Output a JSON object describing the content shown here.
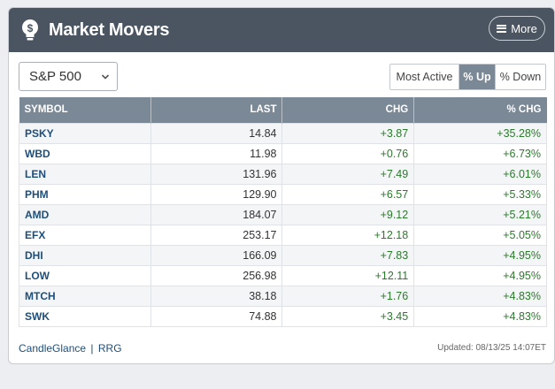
{
  "header": {
    "title": "Market Movers",
    "more_label": "More"
  },
  "index_select": {
    "value": "S&P 500"
  },
  "filters": {
    "most_active": "Most Active",
    "pct_up": "% Up",
    "pct_down": "% Down"
  },
  "table": {
    "headers": [
      "SYMBOL",
      "LAST",
      "CHG",
      "% CHG"
    ],
    "rows": [
      {
        "symbol": "PSKY",
        "last": "14.84",
        "chg": "+3.87",
        "pct": "+35.28%"
      },
      {
        "symbol": "WBD",
        "last": "11.98",
        "chg": "+0.76",
        "pct": "+6.73%"
      },
      {
        "symbol": "LEN",
        "last": "131.96",
        "chg": "+7.49",
        "pct": "+6.01%"
      },
      {
        "symbol": "PHM",
        "last": "129.90",
        "chg": "+6.57",
        "pct": "+5.33%"
      },
      {
        "symbol": "AMD",
        "last": "184.07",
        "chg": "+9.12",
        "pct": "+5.21%"
      },
      {
        "symbol": "EFX",
        "last": "253.17",
        "chg": "+12.18",
        "pct": "+5.05%"
      },
      {
        "symbol": "DHI",
        "last": "166.09",
        "chg": "+7.83",
        "pct": "+4.95%"
      },
      {
        "symbol": "LOW",
        "last": "256.98",
        "chg": "+12.11",
        "pct": "+4.95%"
      },
      {
        "symbol": "MTCH",
        "last": "38.18",
        "chg": "+1.76",
        "pct": "+4.83%"
      },
      {
        "symbol": "SWK",
        "last": "74.88",
        "chg": "+3.45",
        "pct": "+4.83%"
      }
    ]
  },
  "footer": {
    "link1": "CandleGlance",
    "separator": "|",
    "link2": "RRG",
    "updated": "Updated: 08/13/25 14:07ET"
  },
  "colors": {
    "header_bg": "#4a5561",
    "table_header_bg": "#7b8896",
    "positive": "#2b7a2b",
    "link": "#1f4e79"
  },
  "icons": {
    "logo": "lightbulb-icon",
    "menu": "hamburger-icon",
    "select": "chevron-down-icon"
  }
}
